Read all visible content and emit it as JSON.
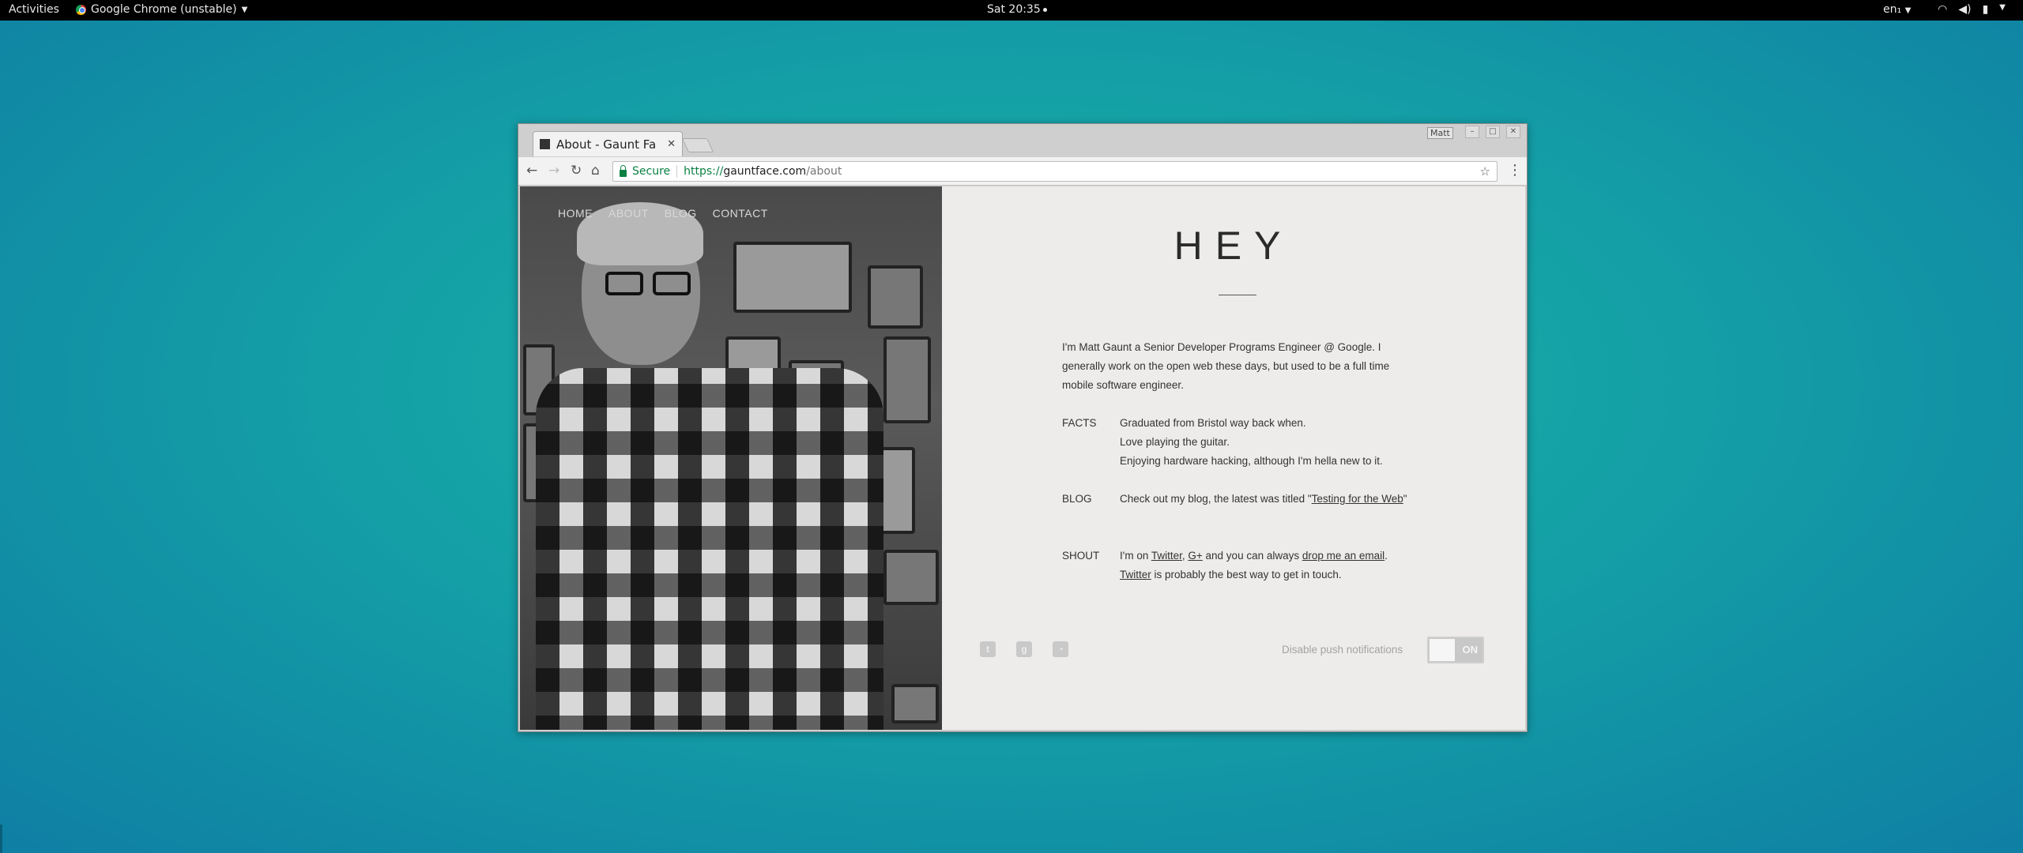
{
  "topbar": {
    "activities": "Activities",
    "app_menu": "Google Chrome (unstable)",
    "clock": "Sat 20:35",
    "lang": "en₁"
  },
  "browser": {
    "tab_title": "About - Gaunt Fa",
    "user_badge": "Matt",
    "secure_label": "Secure",
    "url_scheme": "https://",
    "url_host": "gauntface.com",
    "url_path": "/about"
  },
  "site": {
    "nav": [
      "HOME",
      "ABOUT",
      "BLOG",
      "CONTACT"
    ],
    "heading": "HEY",
    "intro": "I'm Matt Gaunt a Senior Developer Programs Engineer @ Google. I generally work on the open web these days, but used to be a full time mobile software engineer.",
    "facts": {
      "label": "FACTS",
      "items": [
        "Graduated from Bristol way back when.",
        "Love playing the guitar.",
        "Enjoying hardware hacking, although I'm hella new to it."
      ]
    },
    "blog": {
      "label": "BLOG",
      "text_before": "Check out my blog, the latest was titled \"",
      "link": "Testing for the Web",
      "text_after": "\""
    },
    "shout": {
      "label": "SHOUT",
      "t1": "I'm on ",
      "twitter": "Twitter",
      "sep": ", ",
      "gplus": "G+",
      "t2": " and you can always ",
      "email": "drop me an email",
      "t3": ".",
      "twitter2": "Twitter",
      "t4": " is probably the best way to get in touch."
    },
    "footer": {
      "social_icons": [
        "twitter-icon",
        "google-plus-icon",
        "rss-icon"
      ],
      "push_label": "Disable push notifications",
      "toggle_state": "ON"
    }
  },
  "colors": {
    "desktop": "#14a0a6",
    "page_bg": "#edecea",
    "secure_green": "#0b8043"
  }
}
